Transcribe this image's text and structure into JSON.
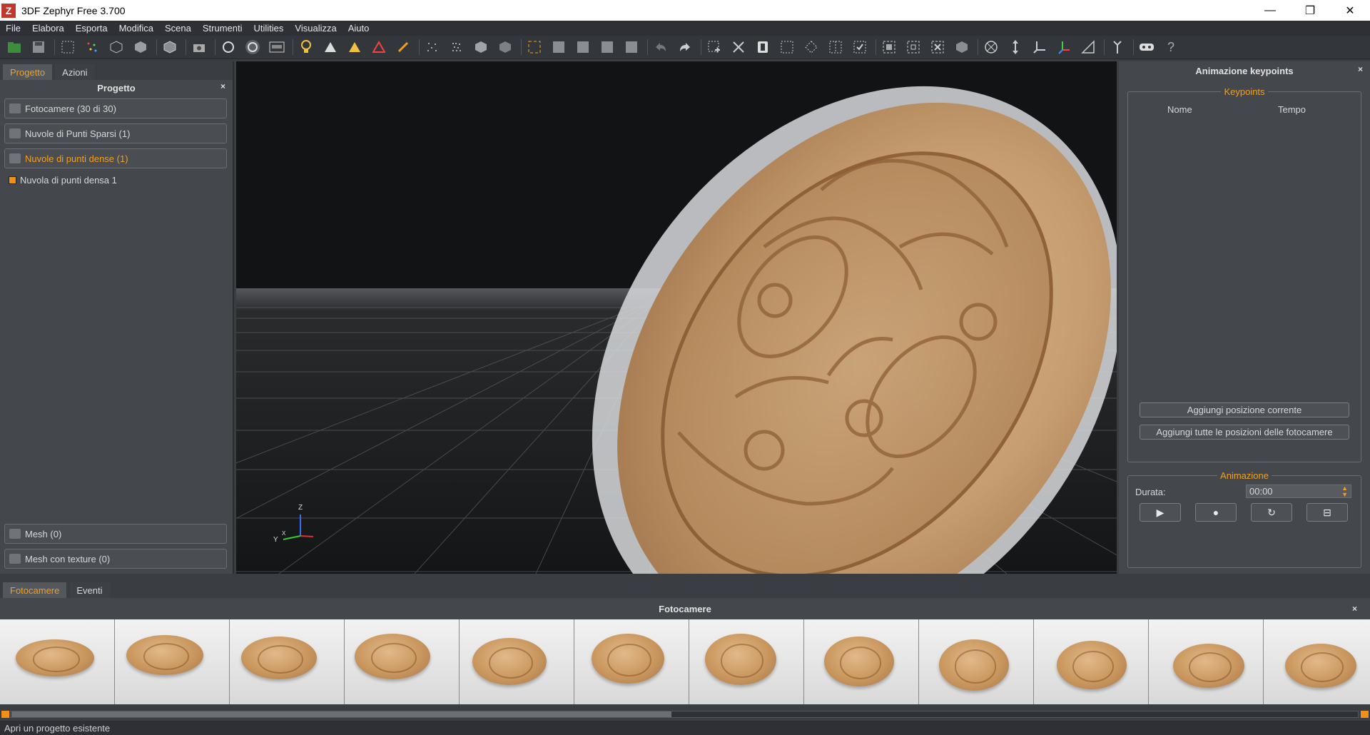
{
  "window": {
    "title": "3DF Zephyr Free 3.700",
    "app_icon_letter": "Z",
    "minimize": "—",
    "restore": "❐",
    "close": "✕"
  },
  "menu": [
    "File",
    "Elabora",
    "Esporta",
    "Modifica",
    "Scena",
    "Strumenti",
    "Utilities",
    "Visualizza",
    "Aiuto"
  ],
  "toolbar": {
    "icons": [
      "new-project-icon",
      "save-icon",
      "select-rect-icon",
      "points-icon",
      "mesh-icon",
      "solid-cube-icon",
      "texture-cube-icon",
      "camera-icon",
      "rotate-icon",
      "orbit-icon",
      "wasd-icon",
      "light-icon",
      "triangle-icon",
      "triangle-yellow-icon",
      "triangle-rgb-icon",
      "brush-icon",
      "sparse-points-icon",
      "dense-points-icon",
      "cube-icon",
      "textured-cube-icon",
      "fit-icon",
      "view-front-icon",
      "view-side-icon",
      "view-top-icon",
      "view-persp-icon",
      "undo-icon",
      "redo-icon",
      "select-add-icon",
      "select-remove-icon",
      "invert-icon",
      "rgb-select-icon",
      "lasso-icon",
      "grid-select-icon",
      "filter-icon",
      "bbox-icon",
      "bbox-resize-icon",
      "bbox-close-icon",
      "box-icon",
      "network-icon",
      "measure-icon",
      "plane-icon",
      "axis-icon",
      "ruler-icon",
      "tools-icon",
      "vr-icon",
      "help-icon"
    ],
    "help_label": "?"
  },
  "left_panel": {
    "tabs": [
      "Progetto",
      "Azioni"
    ],
    "header": "Progetto",
    "close": "×",
    "items": [
      {
        "label": "Fotocamere (30 di 30)"
      },
      {
        "label": "Nuvole di Punti Sparsi (1)"
      },
      {
        "label": "Nuvole di punti dense (1)"
      }
    ],
    "child": "Nuvola di punti densa 1",
    "bottom_items": [
      {
        "label": "Mesh (0)"
      },
      {
        "label": "Mesh con texture (0)"
      }
    ]
  },
  "viewport": {
    "axis_z": "Z",
    "axis_y": "Y",
    "axis_x": "X"
  },
  "right_panel": {
    "title": "Animazione keypoints",
    "close": "×",
    "keypoints_group": "Keypoints",
    "col_name": "Nome",
    "col_time": "Tempo",
    "btn_add_current": "Aggiungi posizione corrente",
    "btn_add_all": "Aggiungi tutte le posizioni delle fotocamere",
    "animation_group": "Animazione",
    "duration_label": "Durata:",
    "duration_value": "00:00",
    "play": "▶",
    "record": "●",
    "loop": "↻",
    "save": "⊟"
  },
  "bottom_panel": {
    "tabs": [
      "Fotocamere",
      "Eventi"
    ],
    "header": "Fotocamere",
    "close": "×",
    "thumb_count": 12
  },
  "status": "Apri un progetto esistente"
}
